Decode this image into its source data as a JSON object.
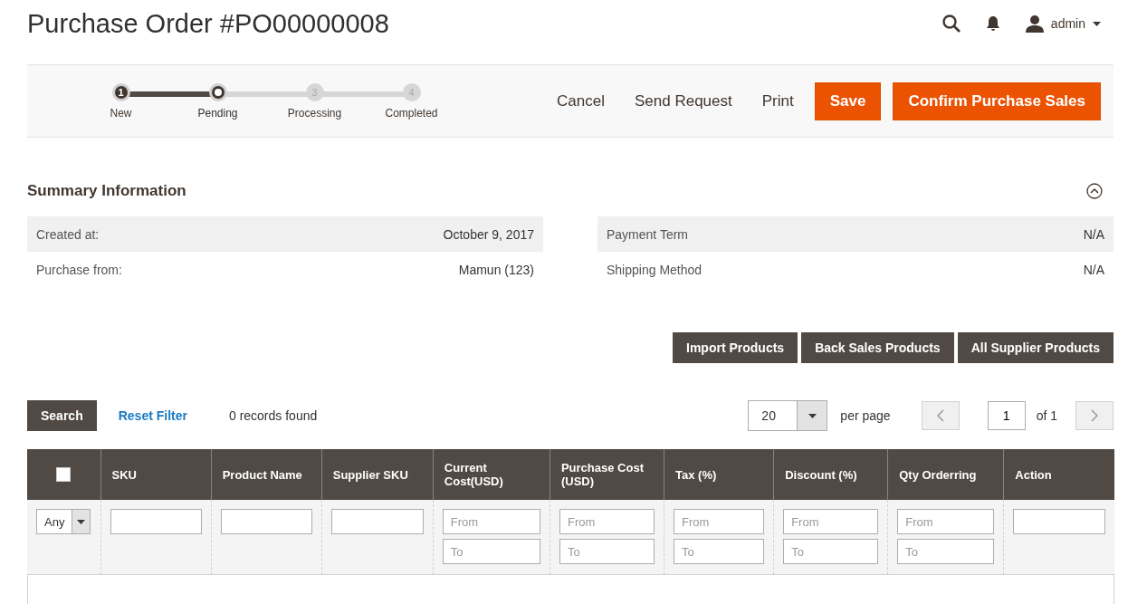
{
  "page_title": "Purchase Order #PO00000008",
  "header": {
    "user": "admin"
  },
  "steps": [
    {
      "number": "1",
      "label": "New",
      "completed": true,
      "selected": false
    },
    {
      "label": "Pending",
      "completed": false,
      "selected": true
    },
    {
      "number": "3",
      "label": "Processing",
      "completed": false,
      "selected": false
    },
    {
      "number": "4",
      "label": "Completed",
      "completed": false,
      "selected": false
    }
  ],
  "actions": [
    {
      "label": "Cancel",
      "kind": "link"
    },
    {
      "label": "Send Request",
      "kind": "link"
    },
    {
      "label": "Print",
      "kind": "link"
    },
    {
      "label": "Save",
      "kind": "primary"
    },
    {
      "label": "Confirm Purchase Sales",
      "kind": "primary"
    }
  ],
  "summary": {
    "title": "Summary Information",
    "expanded": true,
    "left": [
      {
        "label": "Created at:",
        "value": "October 9, 2017"
      },
      {
        "label": "Purchase from:",
        "value": "Mamun (123)"
      }
    ],
    "right": [
      {
        "label": "Payment Term",
        "value": "N/A"
      },
      {
        "label": "Shipping Method",
        "value": "N/A"
      }
    ]
  },
  "product_buttons": [
    "Import Products",
    "Back Sales Products",
    "All Supplier Products"
  ],
  "grid_toolbar": {
    "search": "Search",
    "reset": "Reset Filter",
    "records": "0 records found",
    "per_page_value": "20",
    "per_page_label": "per page",
    "page": "1",
    "of_pages": "of 1"
  },
  "table": {
    "select_all_checked": false,
    "columns": [
      {
        "label": "SKU",
        "kind": "text"
      },
      {
        "label": "Product Name",
        "kind": "text"
      },
      {
        "label": "Supplier SKU",
        "kind": "text"
      },
      {
        "label": "Current Cost(USD)",
        "kind": "range",
        "from_placeholder": "From",
        "to_placeholder": "To"
      },
      {
        "label": "Purchase Cost (USD)",
        "kind": "range",
        "from_placeholder": "From",
        "to_placeholder": "To"
      },
      {
        "label": "Tax (%)",
        "kind": "range",
        "from_placeholder": "From",
        "to_placeholder": "To"
      },
      {
        "label": "Discount (%)",
        "kind": "range",
        "from_placeholder": "From",
        "to_placeholder": "To"
      },
      {
        "label": "Qty Orderring",
        "kind": "range",
        "from_placeholder": "From",
        "to_placeholder": "To"
      },
      {
        "label": "Action",
        "kind": "text"
      }
    ],
    "select_filter": "Any"
  }
}
